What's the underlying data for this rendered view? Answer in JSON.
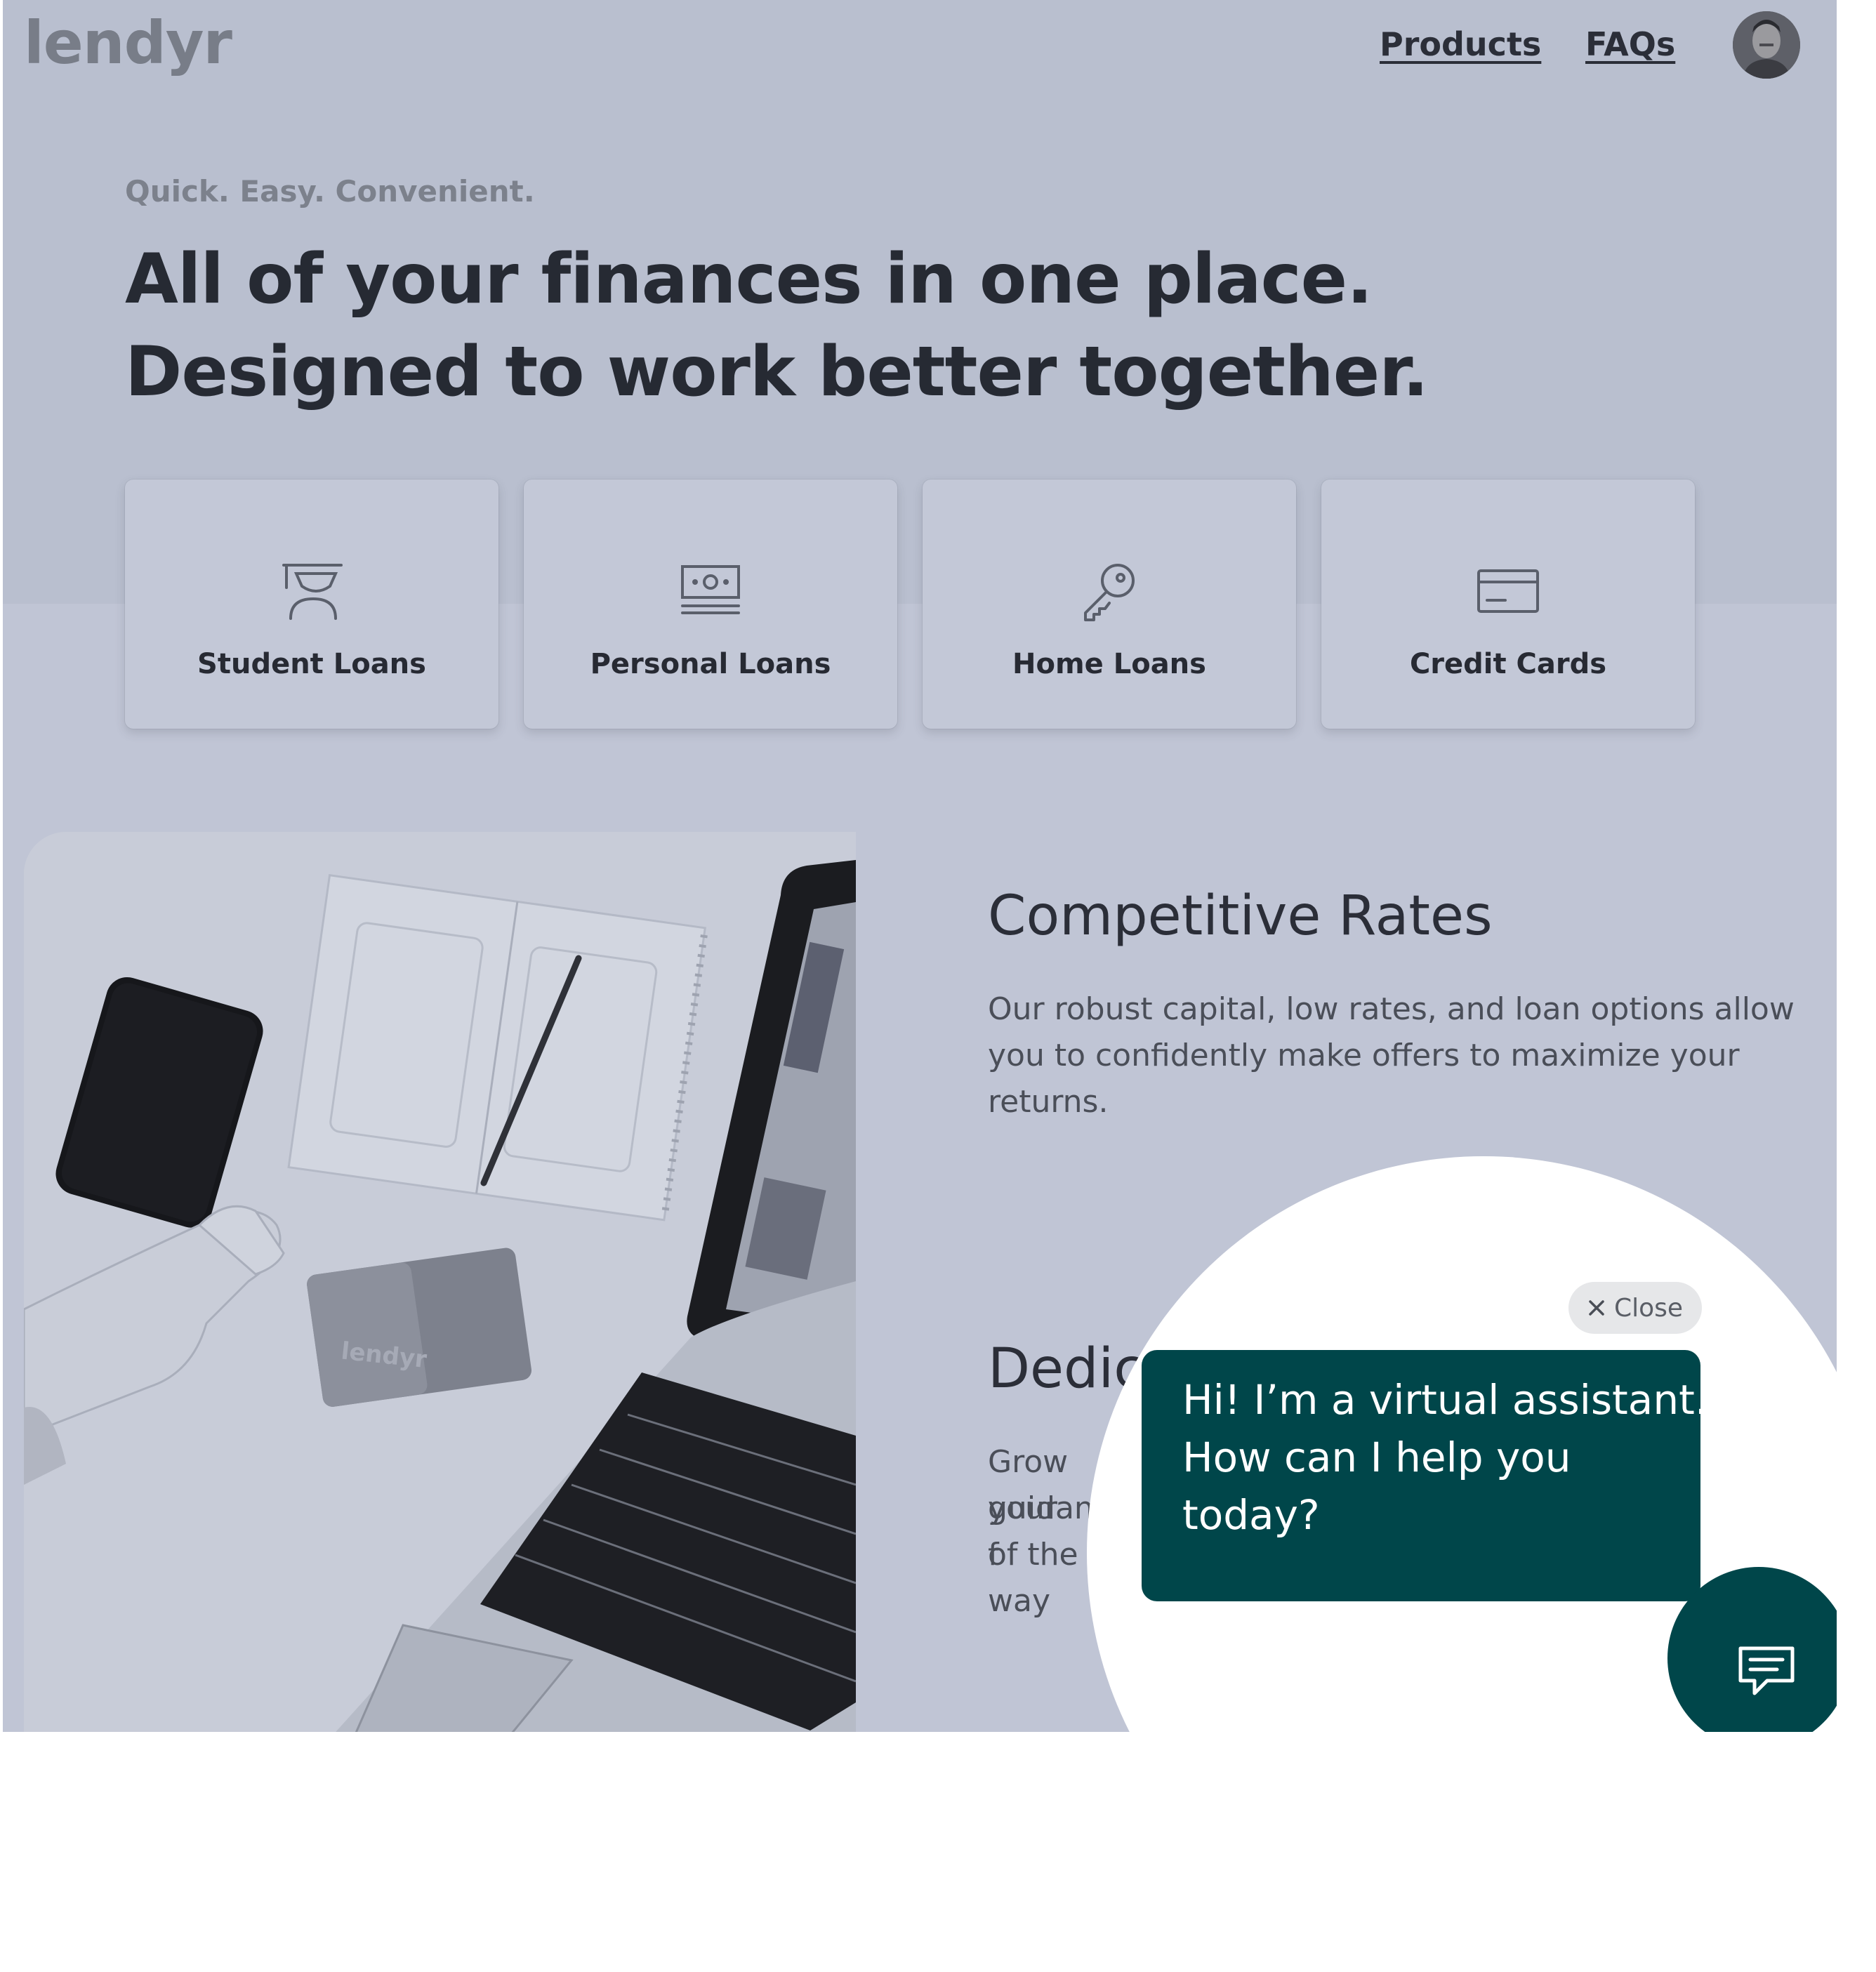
{
  "header": {
    "logo": "lendyr",
    "nav": {
      "products": "Products",
      "faqs": "FAQs"
    }
  },
  "hero": {
    "tagline": "Quick. Easy. Convenient.",
    "headline_line1": "All of your finances in one place.",
    "headline_line2": "Designed to work better together."
  },
  "products": [
    {
      "label": "Student Loans",
      "icon": "graduate-icon"
    },
    {
      "label": "Personal Loans",
      "icon": "cash-icon"
    },
    {
      "label": "Home Loans",
      "icon": "key-icon"
    },
    {
      "label": "Credit Cards",
      "icon": "credit-card-icon"
    }
  ],
  "features": [
    {
      "title": "Competitive Rates",
      "body": "Our robust capital, low rates, and loan options allow you to confidently make offers to maximize your returns."
    },
    {
      "title_visible": "Dedic",
      "body_line1": "Grow your",
      "body_line2a": "guidance f",
      "body_line2b": "step",
      "body_line3": "of the way"
    }
  ],
  "photo": {
    "card_brand": "lendyr"
  },
  "assistant": {
    "close_label": "Close",
    "greeting_line1": "Hi! I’m a virtual assistant.",
    "greeting_line2": "How can I help you",
    "greeting_line3": "today?"
  },
  "colors": {
    "overlay": "#c0c5d5",
    "hero_band": "#b9bfcf",
    "assistant_teal": "#00464a"
  }
}
